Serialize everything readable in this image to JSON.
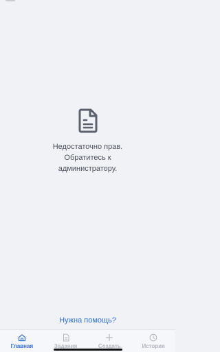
{
  "empty_state": {
    "icon": "document-icon",
    "lines": [
      "Недостаточно прав.",
      "Обратитесь к",
      "администратору."
    ]
  },
  "help_link": "Нужна помощь?",
  "tabbar": {
    "tabs": [
      {
        "label": "Главная",
        "icon": "home-icon",
        "active": true
      },
      {
        "label": "Задания",
        "icon": "document-icon",
        "active": false
      },
      {
        "label": "Создать",
        "icon": "plus-icon",
        "active": false
      },
      {
        "label": "История",
        "icon": "clock-icon",
        "active": false
      }
    ]
  },
  "colors": {
    "background": "#f1f2f6",
    "accent": "#2f6fe0",
    "icon": "#5c6170",
    "tab_inactive": "#b3b7c1"
  }
}
